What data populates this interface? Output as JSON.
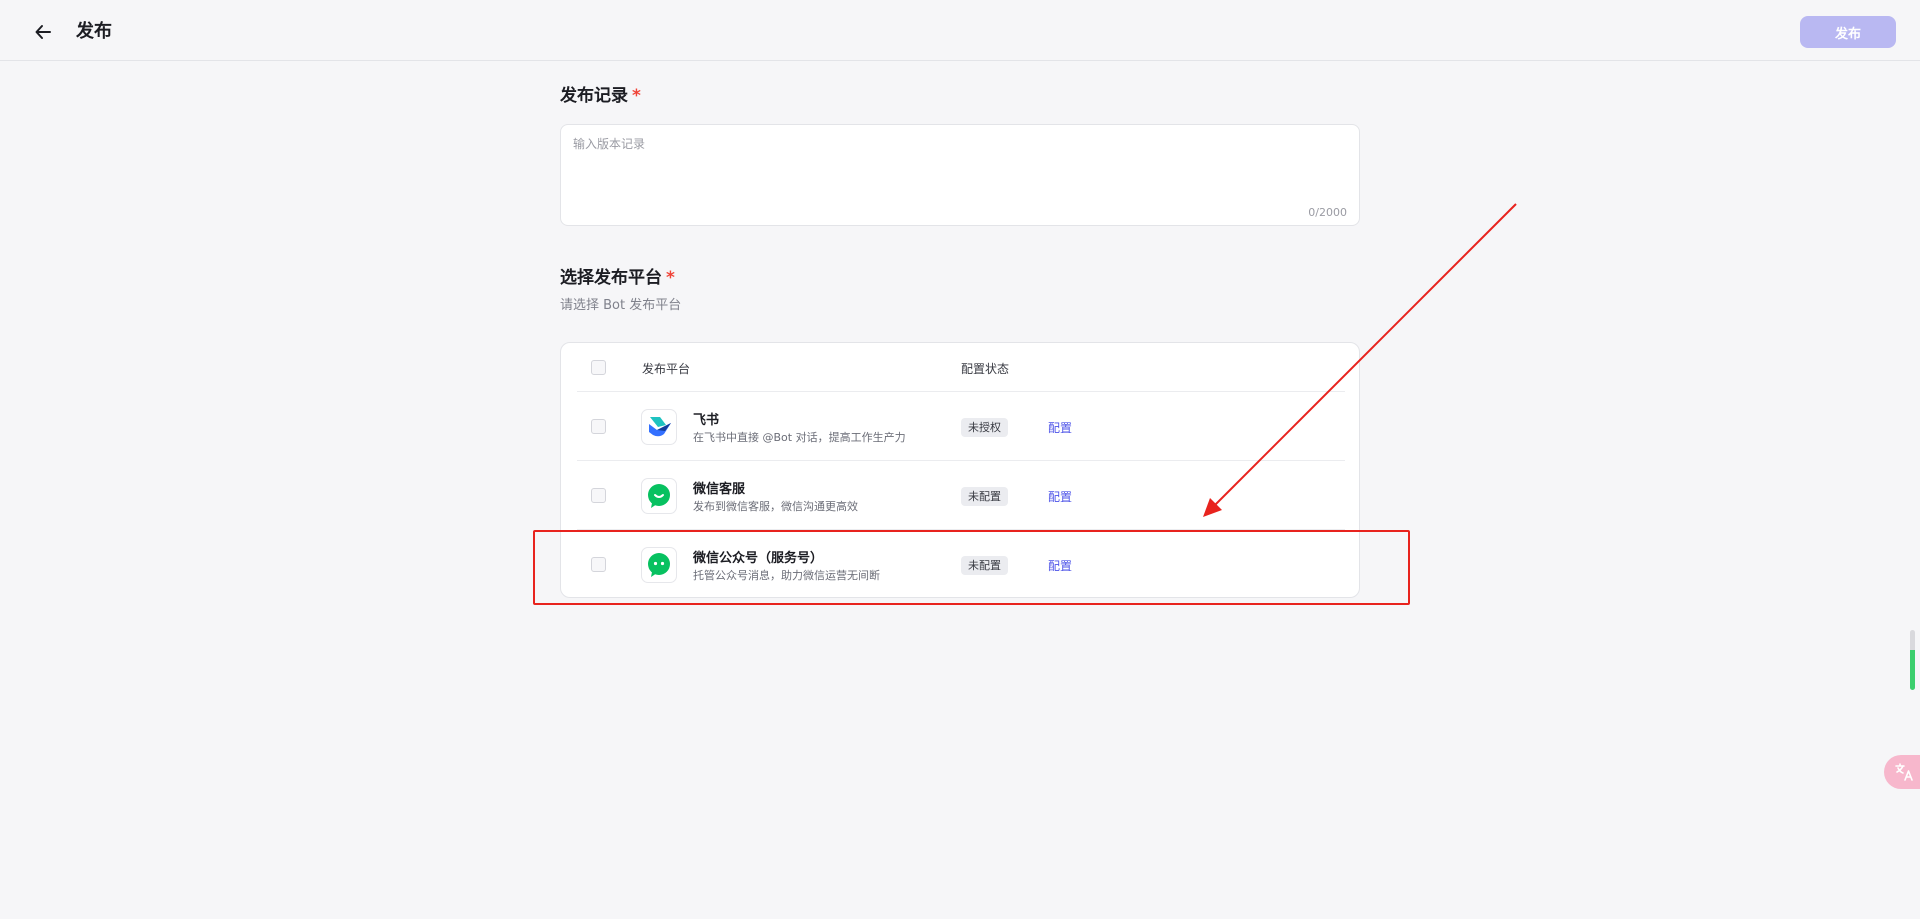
{
  "header": {
    "title": "发布",
    "publish_label": "发布"
  },
  "record": {
    "title": "发布记录",
    "required_mark": "*",
    "placeholder": "输入版本记录",
    "value": "",
    "char_count": "0/2000"
  },
  "platform_section": {
    "title": "选择发布平台",
    "required_mark": "*",
    "subtitle": "请选择 Bot 发布平台",
    "columns": [
      "发布平台",
      "配置状态"
    ],
    "rows": [
      {
        "name": "飞书",
        "desc": "在飞书中直接 @Bot 对话，提高工作生产力",
        "status": "未授权",
        "action": "配置",
        "icon": "feishu-logo-icon",
        "checked": false
      },
      {
        "name": "微信客服",
        "desc": "发布到微信客服，微信沟通更高效",
        "status": "未配置",
        "action": "配置",
        "icon": "wechat-service-icon",
        "checked": false
      },
      {
        "name": "微信公众号（服务号）",
        "desc": "托管公众号消息，助力微信运营无间断",
        "status": "未配置",
        "action": "配置",
        "icon": "wechat-official-account-icon",
        "checked": false
      }
    ]
  },
  "colors": {
    "accent": "#4d53e8",
    "publish_disabled": "#b9b8f2",
    "required": "#f04438",
    "annotation": "#e8231e",
    "wechat_green": "#07c160"
  },
  "icons": {
    "back": "arrow-left-icon",
    "translate": "translate-icon"
  }
}
